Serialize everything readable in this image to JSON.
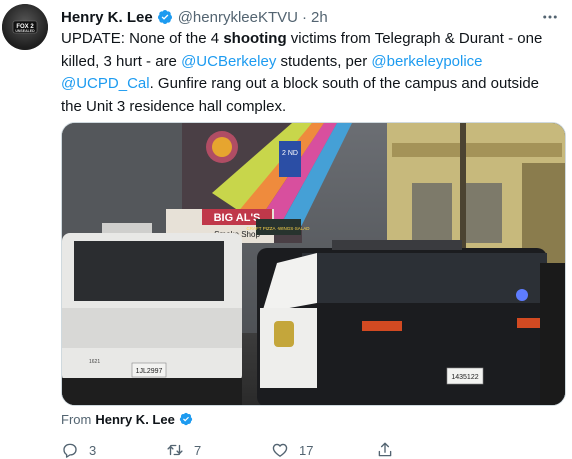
{
  "author": {
    "name": "Henry K. Lee",
    "handle": "@henrykleeKTVU",
    "dot": "·",
    "time": "2h"
  },
  "avatar_text": "FOX 2 UNSEALED",
  "tweet": {
    "t1": "UPDATE: None of the 4 ",
    "t2": "shooting",
    "t3": " victims from Telegraph & Durant - one killed, 3 hurt - are ",
    "mention1": "@UCBerkeley",
    "t4": " students, per ",
    "mention2": "@berkeleypolice",
    "t5": " ",
    "mention3": "@UCPD_Cal",
    "t6": ". Gunfire rang out a block south of the campus and outside the Unit 3 residence hall complex."
  },
  "media": {
    "signs": [
      "BIG AL'S",
      "Smoke Shop",
      "2 ND",
      "CRAFT PIZZA ·WINGS·SALAD"
    ],
    "plate1": "1JL2997",
    "plate2": "1435122",
    "unit": "1621"
  },
  "from": {
    "prefix": "From",
    "name": "Henry K. Lee"
  },
  "actions": {
    "reply_count": "3",
    "retweet_count": "7",
    "like_count": "17"
  },
  "colors": {
    "link": "#1d9bf0",
    "secondary_text": "#536471",
    "verified": "#1d9bf0"
  }
}
